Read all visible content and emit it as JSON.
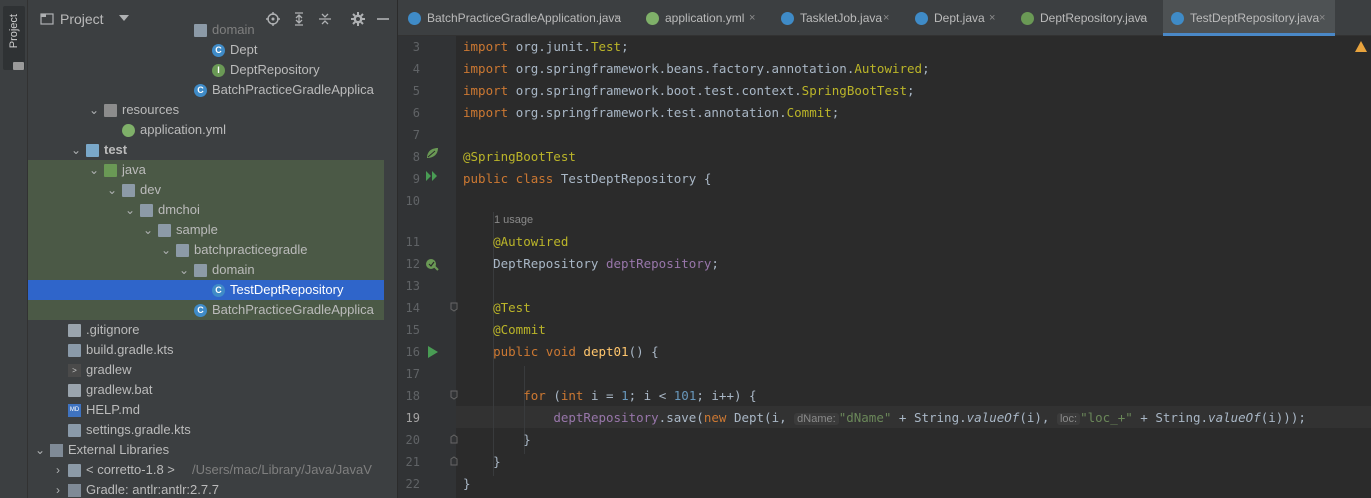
{
  "stripe": {
    "label": "Project"
  },
  "panel": {
    "title": "Project"
  },
  "tree": [
    {
      "label": "domain",
      "indent": 8,
      "icon": "folder-grey",
      "chev": "",
      "style": "dim"
    },
    {
      "label": "Dept",
      "indent": 9,
      "icon": "class",
      "chev": ""
    },
    {
      "label": "DeptRepository",
      "indent": 9,
      "icon": "interface",
      "chev": ""
    },
    {
      "label": "BatchPracticeGradleApplica",
      "indent": 8,
      "icon": "class-spring",
      "chev": ""
    },
    {
      "label": "resources",
      "indent": 3,
      "icon": "folder-resources",
      "chev": "v"
    },
    {
      "label": "application.yml",
      "indent": 4,
      "icon": "yml",
      "chev": ""
    },
    {
      "label": "test",
      "indent": 2,
      "icon": "folder-blue",
      "chev": "v",
      "style": "bold"
    },
    {
      "label": "java",
      "indent": 3,
      "icon": "folder-green",
      "chev": "v",
      "hl": true
    },
    {
      "label": "dev",
      "indent": 4,
      "icon": "folder-grey",
      "chev": "v",
      "hl": true
    },
    {
      "label": "dmchoi",
      "indent": 5,
      "icon": "folder-grey",
      "chev": "v",
      "hl": true
    },
    {
      "label": "sample",
      "indent": 6,
      "icon": "folder-grey",
      "chev": "v",
      "hl": true
    },
    {
      "label": "batchpracticegradle",
      "indent": 7,
      "icon": "folder-grey",
      "chev": "v",
      "hl": true
    },
    {
      "label": "domain",
      "indent": 8,
      "icon": "folder-grey",
      "chev": "v",
      "hl": true
    },
    {
      "label": "TestDeptRepository",
      "indent": 9,
      "icon": "class-test",
      "chev": "",
      "sel": true
    },
    {
      "label": "BatchPracticeGradleApplica",
      "indent": 8,
      "icon": "class-spring",
      "chev": "",
      "hl": true
    },
    {
      "label": ".gitignore",
      "indent": 1,
      "icon": "doc",
      "chev": ""
    },
    {
      "label": "build.gradle.kts",
      "indent": 1,
      "icon": "gradle",
      "chev": ""
    },
    {
      "label": "gradlew",
      "indent": 1,
      "icon": "term",
      "chev": ""
    },
    {
      "label": "gradlew.bat",
      "indent": 1,
      "icon": "doc",
      "chev": ""
    },
    {
      "label": "HELP.md",
      "indent": 1,
      "icon": "md",
      "chev": ""
    },
    {
      "label": "settings.gradle.kts",
      "indent": 1,
      "icon": "gradle",
      "chev": ""
    },
    {
      "label": "External Libraries",
      "indent": 0,
      "icon": "lib",
      "chev": "v"
    },
    {
      "label": "< corretto-1.8 >",
      "indent": 1,
      "icon": "folder-grey",
      "chev": ">",
      "extra": " /Users/mac/Library/Java/JavaV"
    },
    {
      "label": "Gradle: antlr:antlr:2.7.7",
      "indent": 1,
      "icon": "lib",
      "chev": ">"
    }
  ],
  "tabs": [
    {
      "label": "BatchPracticeGradleApplication.java",
      "icon": "spring-class"
    },
    {
      "label": "application.yml",
      "icon": "yml"
    },
    {
      "label": "TaskletJob.java",
      "icon": "class"
    },
    {
      "label": "Dept.java",
      "icon": "class"
    },
    {
      "label": "DeptRepository.java",
      "icon": "interface"
    },
    {
      "label": "TestDeptRepository.java",
      "icon": "class",
      "active": true
    }
  ],
  "code": {
    "line_numbers": [
      "3",
      "4",
      "5",
      "6",
      "7",
      "8",
      "9",
      "10",
      "",
      "11",
      "12",
      "13",
      "14",
      "15",
      "16",
      "17",
      "18",
      "19",
      "20",
      "21",
      "22"
    ],
    "current_line": "19",
    "usage_hint": "1 usage",
    "hint_dname": "dName:",
    "hint_loc": "loc:"
  }
}
